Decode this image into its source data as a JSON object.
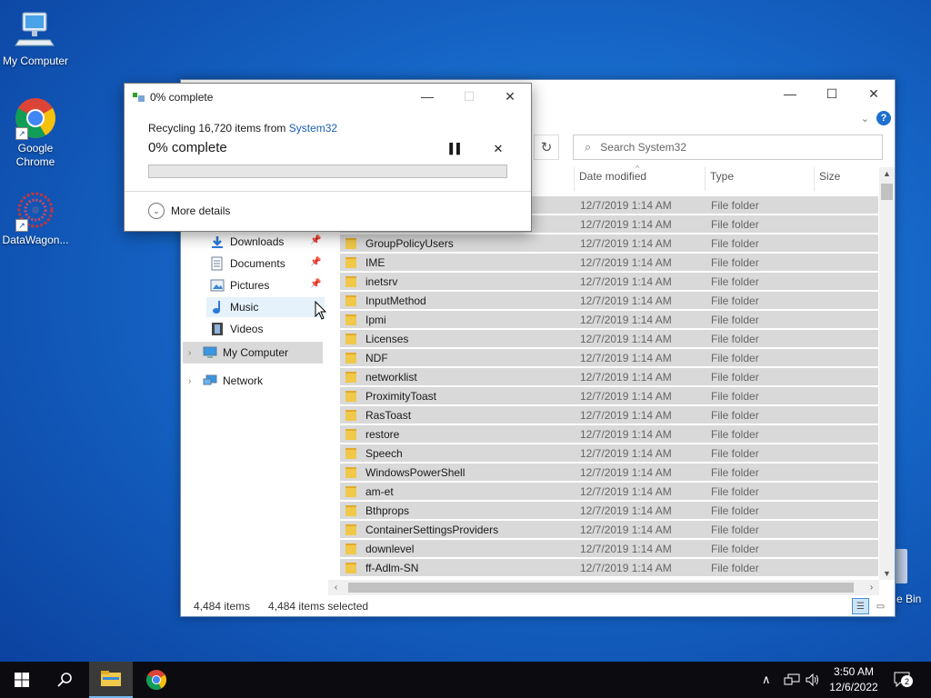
{
  "desktop": {
    "icons": [
      {
        "label": "My Computer"
      },
      {
        "label": "Google\nChrome"
      },
      {
        "label": "DataWagon..."
      }
    ],
    "recycle_bin_label": "e Bin"
  },
  "dialog": {
    "title": "0% complete",
    "message_prefix": "Recycling 16,720 items from ",
    "message_link": "System32",
    "progress_text": "0% complete",
    "progress_fraction": 0.0,
    "more_details": "More details"
  },
  "explorer": {
    "search_placeholder": "Search System32",
    "columns": [
      "Date modified",
      "Type",
      "Size"
    ],
    "nav": [
      {
        "label": "Downloads",
        "icon": "download-icon",
        "pinned": true
      },
      {
        "label": "Documents",
        "icon": "documents-icon",
        "pinned": true
      },
      {
        "label": "Pictures",
        "icon": "pictures-icon",
        "pinned": true
      },
      {
        "label": "Music",
        "icon": "music-icon",
        "pinned": false
      },
      {
        "label": "Videos",
        "icon": "videos-icon",
        "pinned": false
      },
      {
        "label": "My Computer",
        "icon": "computer-icon",
        "pinned": false
      },
      {
        "label": "Network",
        "icon": "network-icon",
        "pinned": false
      }
    ],
    "rows": [
      {
        "name": "",
        "date": "12/7/2019 1:14 AM",
        "type": "File folder"
      },
      {
        "name": "",
        "date": "12/7/2019 1:14 AM",
        "type": "File folder"
      },
      {
        "name": "GroupPolicyUsers",
        "date": "12/7/2019 1:14 AM",
        "type": "File folder"
      },
      {
        "name": "IME",
        "date": "12/7/2019 1:14 AM",
        "type": "File folder"
      },
      {
        "name": "inetsrv",
        "date": "12/7/2019 1:14 AM",
        "type": "File folder"
      },
      {
        "name": "InputMethod",
        "date": "12/7/2019 1:14 AM",
        "type": "File folder"
      },
      {
        "name": "Ipmi",
        "date": "12/7/2019 1:14 AM",
        "type": "File folder"
      },
      {
        "name": "Licenses",
        "date": "12/7/2019 1:14 AM",
        "type": "File folder"
      },
      {
        "name": "NDF",
        "date": "12/7/2019 1:14 AM",
        "type": "File folder"
      },
      {
        "name": "networklist",
        "date": "12/7/2019 1:14 AM",
        "type": "File folder"
      },
      {
        "name": "ProximityToast",
        "date": "12/7/2019 1:14 AM",
        "type": "File folder"
      },
      {
        "name": "RasToast",
        "date": "12/7/2019 1:14 AM",
        "type": "File folder"
      },
      {
        "name": "restore",
        "date": "12/7/2019 1:14 AM",
        "type": "File folder"
      },
      {
        "name": "Speech",
        "date": "12/7/2019 1:14 AM",
        "type": "File folder"
      },
      {
        "name": "WindowsPowerShell",
        "date": "12/7/2019 1:14 AM",
        "type": "File folder"
      },
      {
        "name": "am-et",
        "date": "12/7/2019 1:14 AM",
        "type": "File folder"
      },
      {
        "name": "Bthprops",
        "date": "12/7/2019 1:14 AM",
        "type": "File folder"
      },
      {
        "name": "ContainerSettingsProviders",
        "date": "12/7/2019 1:14 AM",
        "type": "File folder"
      },
      {
        "name": "downlevel",
        "date": "12/7/2019 1:14 AM",
        "type": "File folder"
      },
      {
        "name": "ff-Adlm-SN",
        "date": "12/7/2019 1:14 AM",
        "type": "File folder"
      }
    ],
    "status_count": "4,484 items",
    "status_selected": "4,484 items selected"
  },
  "taskbar": {
    "time": "3:50 AM",
    "date": "12/6/2022",
    "notification_count": "2"
  },
  "colors": {
    "desktop_blue": "#1565c6",
    "selection_gray": "#d9d9d9",
    "link_blue": "#1a5fb4",
    "progress_green": "#06b025",
    "folder_yellow": "#f0c84a"
  }
}
